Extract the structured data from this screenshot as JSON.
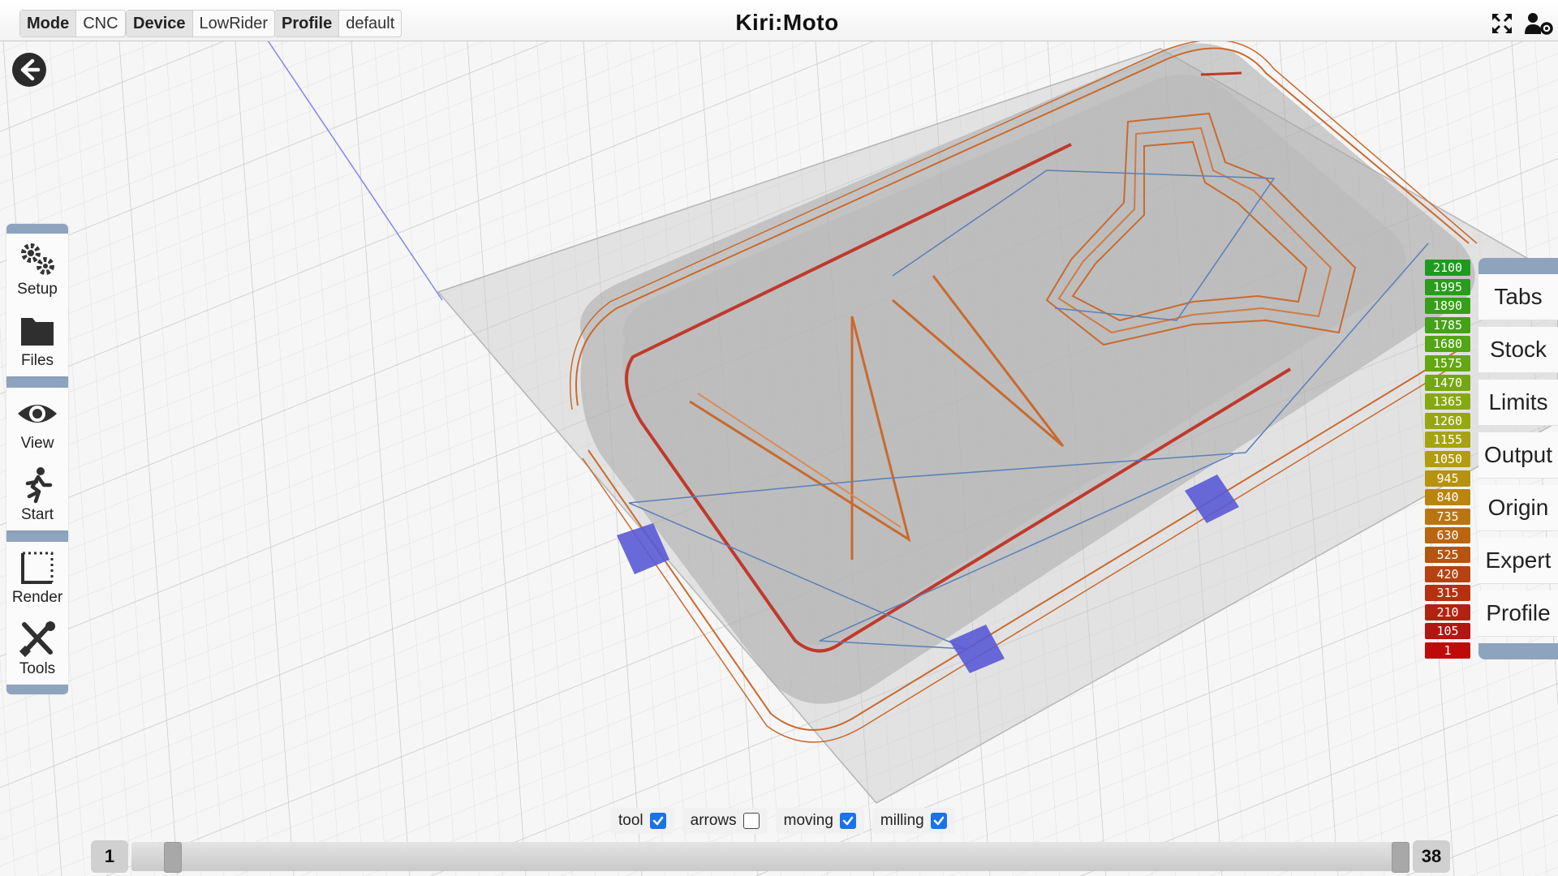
{
  "topbar": {
    "mode_label": "Mode",
    "mode_value": "CNC",
    "device_label": "Device",
    "device_value": "LowRider",
    "profile_label": "Profile",
    "profile_value": "default",
    "app_title": "Kiri:Moto",
    "fullscreen_icon": "fullscreen-icon",
    "account_icon": "user-settings-icon"
  },
  "back_button": {
    "icon": "arrow-left-circle-icon"
  },
  "left_menu": {
    "groups": [
      [
        {
          "label": "Setup",
          "icon": "gears-icon"
        },
        {
          "label": "Files",
          "icon": "folder-icon"
        }
      ],
      [
        {
          "label": "View",
          "icon": "eye-icon"
        },
        {
          "label": "Start",
          "icon": "running-figure-icon"
        }
      ],
      [
        {
          "label": "Render",
          "icon": "dotted-frame-icon"
        },
        {
          "label": "Tools",
          "icon": "tools-icon"
        }
      ]
    ]
  },
  "right_panel": {
    "items": [
      "Tabs",
      "Stock",
      "Limits",
      "Output",
      "Origin",
      "Expert",
      "Profile"
    ]
  },
  "speed_legend": [
    {
      "value": "2100",
      "color": "#1f9a1f"
    },
    {
      "value": "1995",
      "color": "#2a9c1c"
    },
    {
      "value": "1890",
      "color": "#369f19"
    },
    {
      "value": "1785",
      "color": "#44a217"
    },
    {
      "value": "1680",
      "color": "#53a515"
    },
    {
      "value": "1575",
      "color": "#63a713"
    },
    {
      "value": "1470",
      "color": "#74a812"
    },
    {
      "value": "1365",
      "color": "#86a911"
    },
    {
      "value": "1260",
      "color": "#96a710"
    },
    {
      "value": "1155",
      "color": "#a6a310"
    },
    {
      "value": "1050",
      "color": "#b29c10"
    },
    {
      "value": "945",
      "color": "#b79110"
    },
    {
      "value": "840",
      "color": "#b98410"
    },
    {
      "value": "735",
      "color": "#b97610"
    },
    {
      "value": "630",
      "color": "#b86610"
    },
    {
      "value": "525",
      "color": "#b75410"
    },
    {
      "value": "420",
      "color": "#b54210"
    },
    {
      "value": "315",
      "color": "#b43110"
    },
    {
      "value": "210",
      "color": "#b32210"
    },
    {
      "value": "105",
      "color": "#b31510"
    },
    {
      "value": "1",
      "color": "#c00a0a"
    }
  ],
  "toggles": [
    {
      "label": "tool",
      "checked": true
    },
    {
      "label": "arrows",
      "checked": false
    },
    {
      "label": "moving",
      "checked": true
    },
    {
      "label": "milling",
      "checked": true
    }
  ],
  "layer_slider": {
    "min": "1",
    "max": "38"
  }
}
